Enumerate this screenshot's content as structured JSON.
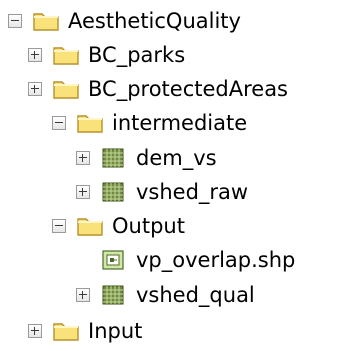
{
  "tree": {
    "items": [
      {
        "label": "AestheticQuality",
        "toggle": "minus",
        "icon": "folder-icon"
      },
      {
        "label": "BC_parks",
        "toggle": "plus",
        "icon": "folder-icon"
      },
      {
        "label": "BC_protectedAreas",
        "toggle": "plus",
        "icon": "folder-icon"
      },
      {
        "label": "intermediate",
        "toggle": "minus",
        "icon": "folder-icon"
      },
      {
        "label": "dem_vs",
        "toggle": "plus",
        "icon": "raster-icon"
      },
      {
        "label": "vshed_raw",
        "toggle": "plus",
        "icon": "raster-icon"
      },
      {
        "label": "Output",
        "toggle": "minus",
        "icon": "folder-icon"
      },
      {
        "label": "vp_overlap.shp",
        "toggle": "none",
        "icon": "shapefile-icon"
      },
      {
        "label": "vshed_qual",
        "toggle": "plus",
        "icon": "raster-icon"
      },
      {
        "label": "Input",
        "toggle": "plus",
        "icon": "folder-icon"
      }
    ]
  },
  "colors": {
    "folder_fill": "#f9e27a",
    "folder_stroke": "#b8912c",
    "raster_fill": "#6e8b3d",
    "shapefile_fill": "#cfe7a7"
  }
}
